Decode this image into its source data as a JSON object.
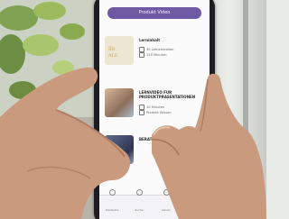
{
  "app": {
    "primary_button": "Produkt Video"
  },
  "cards": [
    {
      "title": "Lerninhalt",
      "meta": [
        "30 Lerneinheiten",
        "120 Minuten"
      ]
    },
    {
      "title": "LERNVIDEO FUR PRODUKTPRASENTATIONEN",
      "meta": [
        "10 Minuten",
        "Produkt Wissen"
      ]
    },
    {
      "title": "BERATUNG IM FACHHANDEL UND",
      "meta": []
    }
  ],
  "nav": [
    "Startseite",
    "Suche",
    "Lernen",
    "Profil"
  ],
  "colors": {
    "accent": "#6e5aa3",
    "screen": "#fbfbfb",
    "phone": "#1e1e22",
    "skin": "#c99a7e"
  },
  "icons": [
    "clock-icon",
    "list-icon",
    "home-icon",
    "search-icon",
    "book-icon",
    "profile-icon"
  ]
}
